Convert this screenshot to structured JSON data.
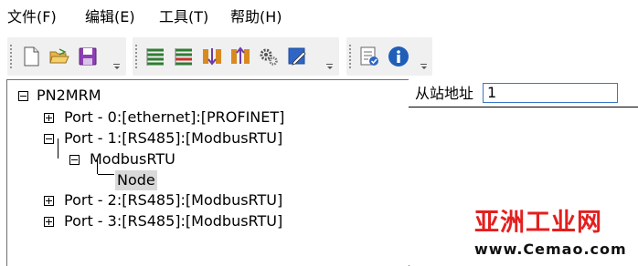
{
  "menubar": {
    "items": [
      {
        "label": "文件(F)"
      },
      {
        "label": "编辑(E)"
      },
      {
        "label": "工具(T)"
      },
      {
        "label": "帮助(H)"
      }
    ]
  },
  "toolbar": {
    "groups": [
      {
        "buttons": [
          "new-file-icon",
          "open-folder-icon",
          "save-icon"
        ]
      },
      {
        "buttons": [
          "add-port-icon",
          "remove-port-icon",
          "download-icon",
          "upload-icon",
          "settings-gear-icon",
          "edit-icon"
        ]
      },
      {
        "buttons": [
          "config-check-icon",
          "info-icon"
        ]
      }
    ]
  },
  "tree": {
    "root": {
      "label": "PN2MRM"
    },
    "ports": [
      {
        "label": "Port - 0:[ethernet]:[PROFINET]",
        "expanded": false
      },
      {
        "label": "Port - 1:[RS485]:[ModbusRTU]",
        "expanded": true
      },
      {
        "label": "Port - 2:[RS485]:[ModbusRTU]",
        "expanded": false
      },
      {
        "label": "Port - 3:[RS485]:[ModbusRTU]",
        "expanded": false
      }
    ],
    "protocol": {
      "label": "ModbusRTU"
    },
    "node": {
      "label": "Node",
      "selected": true
    }
  },
  "properties": {
    "slave_address_label": "从站地址",
    "slave_address_value": "1"
  },
  "watermark": {
    "title": "亚洲工业网",
    "url": "www.Cemao.com"
  },
  "colors": {
    "toolbar_bg": "#f0f0f0",
    "input_border": "#3a78c6",
    "selection": "#d9d9d9",
    "watermark_red": "#e41e1e"
  }
}
